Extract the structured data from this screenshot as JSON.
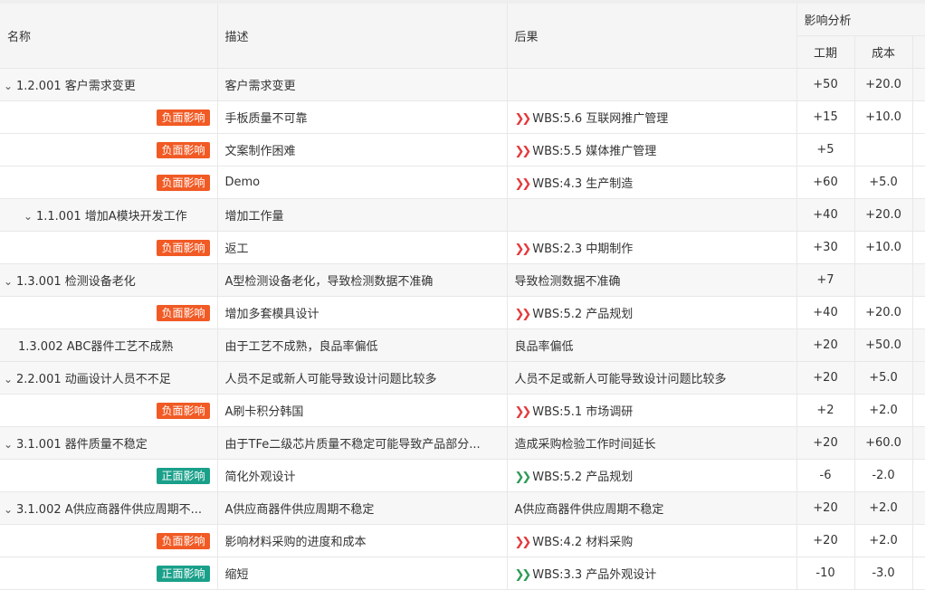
{
  "header": {
    "col_name": "名称",
    "col_desc": "描述",
    "col_result": "后果",
    "col_impact": "影响分析",
    "col_period": "工期",
    "col_cost": "成本"
  },
  "colors": {
    "negative": "#f15a24",
    "positive": "#1aa08a"
  },
  "rows": [
    {
      "type": "parent",
      "level": 0,
      "caret": true,
      "name": "1.2.001 客户需求变更",
      "desc": "客户需求变更",
      "result": "",
      "period": "+50",
      "cost": "+20.0"
    },
    {
      "type": "child",
      "badge": "负面影响",
      "badge_kind": "neg",
      "desc": "手板质量不可靠",
      "result": "WBS:5.6 互联网推广管理",
      "period": "+15",
      "cost": "+10.0"
    },
    {
      "type": "child",
      "badge": "负面影响",
      "badge_kind": "neg",
      "desc": "文案制作困难",
      "result": "WBS:5.5 媒体推广管理",
      "period": "+5",
      "cost": ""
    },
    {
      "type": "child",
      "badge": "负面影响",
      "badge_kind": "neg",
      "desc": "Demo",
      "result": "WBS:4.3 生产制造",
      "period": "+60",
      "cost": "+5.0"
    },
    {
      "type": "parent",
      "level": 1,
      "caret": true,
      "name": "1.1.001 增加A模块开发工作",
      "desc": "增加工作量",
      "result": "",
      "period": "+40",
      "cost": "+20.0"
    },
    {
      "type": "child",
      "badge": "负面影响",
      "badge_kind": "neg",
      "desc": "返工",
      "result": "WBS:2.3 中期制作",
      "period": "+30",
      "cost": "+10.0"
    },
    {
      "type": "parent",
      "level": 0,
      "caret": true,
      "name": "1.3.001 检测设备老化",
      "desc": "A型检测设备老化，导致检测数据不准确",
      "result": "导致检测数据不准确",
      "period": "+7",
      "cost": ""
    },
    {
      "type": "child",
      "badge": "负面影响",
      "badge_kind": "neg",
      "desc": "增加多套模具设计",
      "result": "WBS:5.2 产品规划",
      "period": "+40",
      "cost": "+20.0"
    },
    {
      "type": "parent",
      "level": 0,
      "caret": false,
      "name": "1.3.002 ABC器件工艺不成熟",
      "desc": "由于工艺不成熟，良品率偏低",
      "result": "良品率偏低",
      "period": "+20",
      "cost": "+50.0"
    },
    {
      "type": "parent",
      "level": 0,
      "caret": true,
      "name": "2.2.001 动画设计人员不不足",
      "desc": "人员不足或新人可能导致设计问题比较多",
      "result": "人员不足或新人可能导致设计问题比较多",
      "period": "+20",
      "cost": "+5.0"
    },
    {
      "type": "child",
      "badge": "负面影响",
      "badge_kind": "neg",
      "desc": "A刷卡积分韩国",
      "result": "WBS:5.1 市场调研",
      "period": "+2",
      "cost": "+2.0"
    },
    {
      "type": "parent",
      "level": 0,
      "caret": true,
      "name": "3.1.001 器件质量不稳定",
      "desc": "由于TFe二级芯片质量不稳定可能导致产品部分...",
      "result": "造成采购检验工作时间延长",
      "period": "+20",
      "cost": "+60.0"
    },
    {
      "type": "child",
      "badge": "正面影响",
      "badge_kind": "pos",
      "desc": "简化外观设计",
      "result": "WBS:5.2 产品规划",
      "period": "-6",
      "cost": "-2.0"
    },
    {
      "type": "parent",
      "level": 0,
      "caret": true,
      "name": "3.1.002 A供应商器件供应周期不...",
      "desc": "A供应商器件供应周期不稳定",
      "result": "A供应商器件供应周期不稳定",
      "period": "+20",
      "cost": "+2.0"
    },
    {
      "type": "child",
      "badge": "负面影响",
      "badge_kind": "neg",
      "desc": "影响材料采购的进度和成本",
      "result": "WBS:4.2 材料采购",
      "period": "+20",
      "cost": "+2.0"
    },
    {
      "type": "child",
      "badge": "正面影响",
      "badge_kind": "pos",
      "desc": "缩短",
      "result": "WBS:3.3 产品外观设计",
      "period": "-10",
      "cost": "-3.0"
    }
  ]
}
